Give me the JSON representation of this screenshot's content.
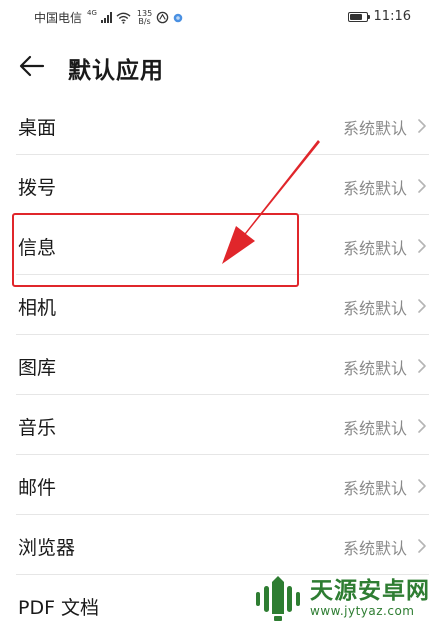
{
  "status_bar": {
    "carrier": "中国电信",
    "network_badge": "4G",
    "speed_value": "135",
    "speed_unit": "B/s",
    "time": "11:16",
    "battery_level": 0.8
  },
  "header": {
    "title": "默认应用",
    "back_icon": "arrow-left-icon"
  },
  "list": {
    "items": [
      {
        "label": "桌面",
        "value": "系统默认"
      },
      {
        "label": "拨号",
        "value": "系统默认"
      },
      {
        "label": "信息",
        "value": "系统默认"
      },
      {
        "label": "相机",
        "value": "系统默认"
      },
      {
        "label": "图库",
        "value": "系统默认"
      },
      {
        "label": "音乐",
        "value": "系统默认"
      },
      {
        "label": "邮件",
        "value": "系统默认"
      },
      {
        "label": "浏览器",
        "value": "系统默认"
      },
      {
        "label": "PDF 文档",
        "value": ""
      }
    ]
  },
  "annotation": {
    "color": "#e0262b",
    "highlighted_item": "信息"
  },
  "watermark": {
    "name": "天源安卓网",
    "url": "www.jytyaz.com",
    "color": "#2e7d32"
  }
}
